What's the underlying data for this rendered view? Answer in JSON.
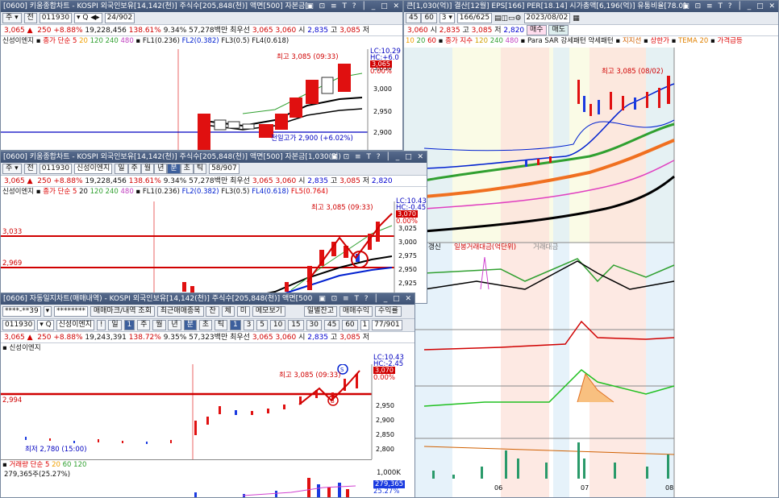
{
  "colors": {
    "up": "#e01010",
    "down": "#1a3ae0",
    "title": "#4a5e82"
  },
  "w_back_left": {
    "title": "[0600] 키움종합차트 - KOSPI 외국인보유[14,142(천)] 주식수[205,848(천)] 액면[500] 자본금[",
    "code": "011930",
    "period": "24/902",
    "quote": [
      "3,065 ▲",
      "250",
      "+8.88%",
      "19,228,456",
      "138.61%",
      "9.34%",
      "57,278백만",
      "최우선",
      "3,065",
      "3,060",
      "시",
      "2,835",
      "고",
      "3,085",
      "저"
    ],
    "legend": [
      "신성이엔지",
      "종가",
      "단순",
      "5",
      "20",
      "120",
      "240",
      "480",
      "FL1(0.236)",
      "FL2(0.382)",
      "FL3(0.5)",
      "FL4(0.618)",
      "FL5(0.764)"
    ],
    "anno_high": "최고 3,085 (09:33)",
    "anno_prev": "전일고가 2,900 (+6.02%)",
    "y_ticks": [
      "3,050",
      "3,000",
      "2,950",
      "2,900"
    ],
    "y_tags": [
      "LC:10.29",
      "HC:+6.0",
      "3,065",
      "0.00%"
    ]
  },
  "w_right": {
    "title": "큰[1,030(억)] 결산[12월] EPS[166] PER[18.14] 시가총액[6,196(억)] 유통비율[78.0]",
    "period": "166/625",
    "date": "2023/08/02",
    "quote": [
      "3,060",
      "시",
      "2,835",
      "고",
      "3,085",
      "저",
      "2,820"
    ],
    "buy_label": "매수",
    "sell_label": "매도",
    "legend": [
      "10",
      "20",
      "60",
      "종가",
      "지수",
      "120",
      "240",
      "480",
      "Para SAR",
      "강세패턴",
      "약세패턴",
      "지지선",
      "상한가",
      "TEMA 20",
      "가격급등"
    ],
    "anno_high": "최고 3,085 (08/02)",
    "sub_legend": [
      "갱신",
      "일봉거래대금(억단위)",
      "거래대금"
    ],
    "x_labels": [
      "06",
      "07",
      "08"
    ]
  },
  "w_mid": {
    "title": "[0600] 키움종합차트 - KOSPI 외국인보유[14,142(천)] 주식수[205,848(천)] 액면[500] 자본금[1,030(억)",
    "code": "011930",
    "stock": "신성이엔지",
    "period": "58/907",
    "quote": [
      "3,065 ▲",
      "250",
      "+8.88%",
      "19,228,456",
      "138.61%",
      "9.34%",
      "57,278백만",
      "최우선",
      "3,065",
      "3,060",
      "시",
      "2,835",
      "고",
      "3,085",
      "저",
      "2,820"
    ],
    "legend": [
      "신성이엔지",
      "종가",
      "단순",
      "5",
      "20",
      "120",
      "240",
      "480",
      "FL1(0.236)",
      "FL2(0.382)",
      "FL3(0.5)",
      "FL4(0.618)",
      "FL5(0.764)"
    ],
    "anno_high": "최고 3,085 (09:33)",
    "left_vals": [
      "3,033",
      "2,969"
    ],
    "y_ticks": [
      "3,025",
      "3,000",
      "2,975",
      "2,950",
      "2,925"
    ],
    "y_tags": [
      "LC:10.43",
      "HC:-0.45",
      "3,070",
      "0.00%"
    ]
  },
  "w_front": {
    "title": "[0606] 자동일지차트(매매내역) - KOSPI 외국인보유[14,142(천)] 주식수[205,848(천)] 액면[500",
    "account": "****-**39",
    "password": "********",
    "buttons": [
      "매매마크/내역 조회",
      "최근매매종목",
      "잔",
      "체",
      "미",
      "메모보기",
      "일별잔고",
      "매매수익",
      "수익률"
    ],
    "code": "011930",
    "stock": "신성이엔지",
    "period": "77/901",
    "tf": [
      "!",
      "일",
      "1",
      "주",
      "월",
      "년",
      "분",
      "초",
      "틱",
      "1",
      "3",
      "5",
      "10",
      "15",
      "30",
      "45",
      "60",
      "1"
    ],
    "quote": [
      "3,065 ▲",
      "250",
      "+8.88%",
      "19,243,391",
      "138.72%",
      "9.35%",
      "57,323백만",
      "최우선",
      "3,065",
      "3,060",
      "시",
      "2,835",
      "고",
      "3,085",
      "저"
    ],
    "legend": "신성이엔지",
    "anno_high": "최고 3,085 (09:33)",
    "anno_low": "최저 2,780 (15:00)",
    "left_val": "2,994",
    "y_ticks": [
      "2,950",
      "2,900",
      "2,850",
      "2,800"
    ],
    "y_tags": [
      "LC:10.43",
      "HC:-2.45",
      "3,070",
      "0.00%"
    ],
    "marker_s": "S",
    "marker_b": "B",
    "vol_legend": [
      "거래량",
      "단순",
      "5",
      "20",
      "60",
      "120"
    ],
    "vol_value": "279,365주(25.27%)",
    "vol_tags": [
      "1,000K",
      "279,365",
      "25.27%"
    ]
  }
}
